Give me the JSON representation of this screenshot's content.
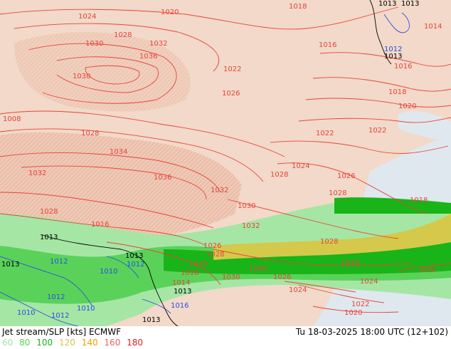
{
  "footer": {
    "title": "Jet stream/SLP [kts] ECMWF",
    "time": "Tu 18-03-2025 18:00 UTC (12+102)"
  },
  "legend": {
    "items": [
      {
        "label": "60",
        "color": "#a5e6a5"
      },
      {
        "label": "80",
        "color": "#5ad25a"
      },
      {
        "label": "100",
        "color": "#18b418"
      },
      {
        "label": "120",
        "color": "#d4c94a"
      },
      {
        "label": "140",
        "color": "#f0a000"
      },
      {
        "label": "160",
        "color": "#f06060"
      },
      {
        "label": "180",
        "color": "#e01e1e"
      }
    ]
  },
  "map": {
    "colors": {
      "land": "#f2d9c9",
      "high_terrain": "#e9b9a5",
      "sea": "#dde6ec",
      "isobar_high": "#e8443a",
      "isobar_low": "#2b4de0",
      "isobar_neutral": "#000000",
      "jet_60": "#a5e6a5",
      "jet_80": "#5ad25a",
      "jet_100": "#18b418",
      "jet_120": "#d4c94a"
    },
    "labels_high": [
      "1020",
      "1024",
      "1028",
      "1030",
      "1032",
      "1036",
      "1018",
      "1016",
      "1022",
      "1026",
      "1034",
      "1014",
      "1012",
      "1008"
    ],
    "labels_low": [
      "1012",
      "1010",
      "1016",
      "1014",
      "1013"
    ],
    "labels_neutral": [
      "1013"
    ]
  }
}
